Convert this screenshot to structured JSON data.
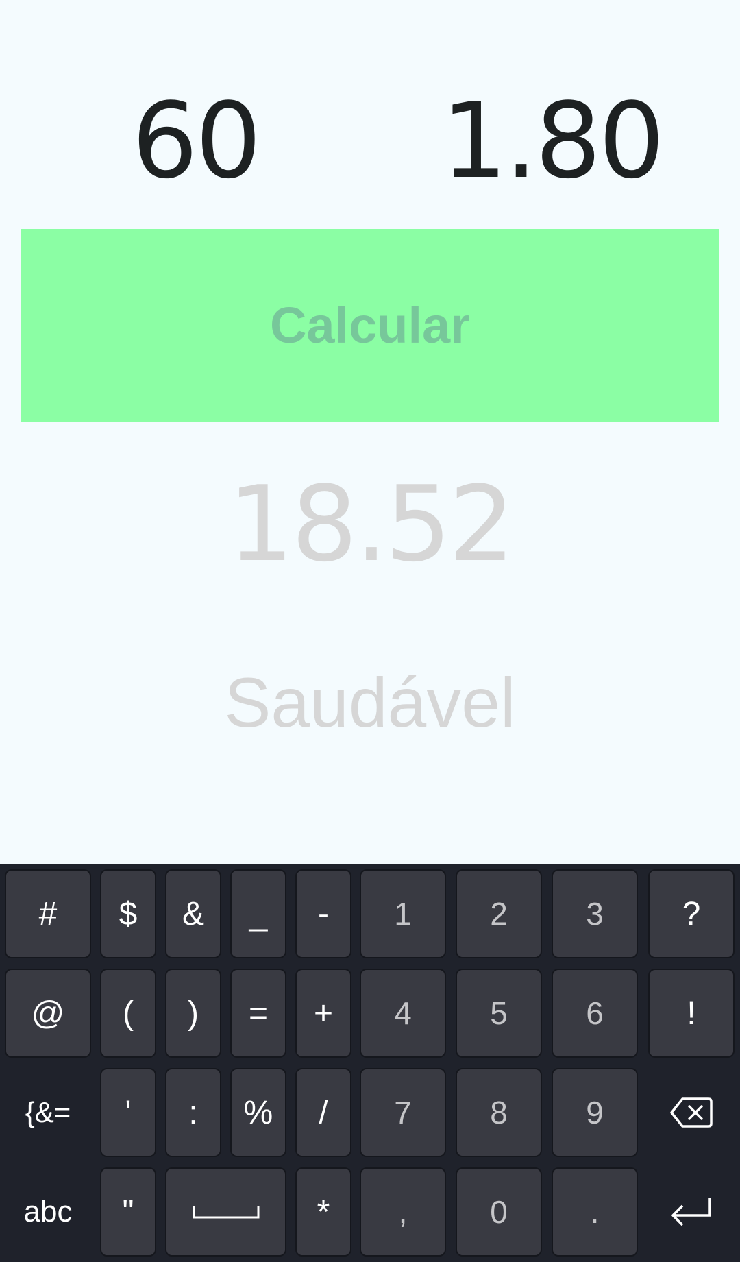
{
  "inputs": {
    "weight_value": "60",
    "height_value": "1.80"
  },
  "button": {
    "calculate_label": "Calcular"
  },
  "result": {
    "value": "18.52",
    "label": "Saudável"
  },
  "colors": {
    "button_bg": "#8bfea4",
    "button_text": "#77c79a",
    "result_text": "#d6d6d6",
    "background": "#f4fbfe",
    "keyboard_bg": "#1f222b"
  },
  "keyboard": {
    "row1": [
      "#",
      "$",
      "&",
      "_",
      "-",
      "1",
      "2",
      "3",
      "?"
    ],
    "row2": [
      "@",
      "(",
      ")",
      "=",
      "+",
      "4",
      "5",
      "6",
      "!"
    ],
    "row3": [
      "{&=",
      "'",
      ":",
      "%",
      "/",
      "7",
      "8",
      "9"
    ],
    "row4": [
      "abc",
      "\"",
      "*",
      ",",
      "0",
      "."
    ],
    "icons": {
      "backspace": "backspace-icon",
      "space": "space-icon",
      "enter": "enter-icon"
    }
  }
}
